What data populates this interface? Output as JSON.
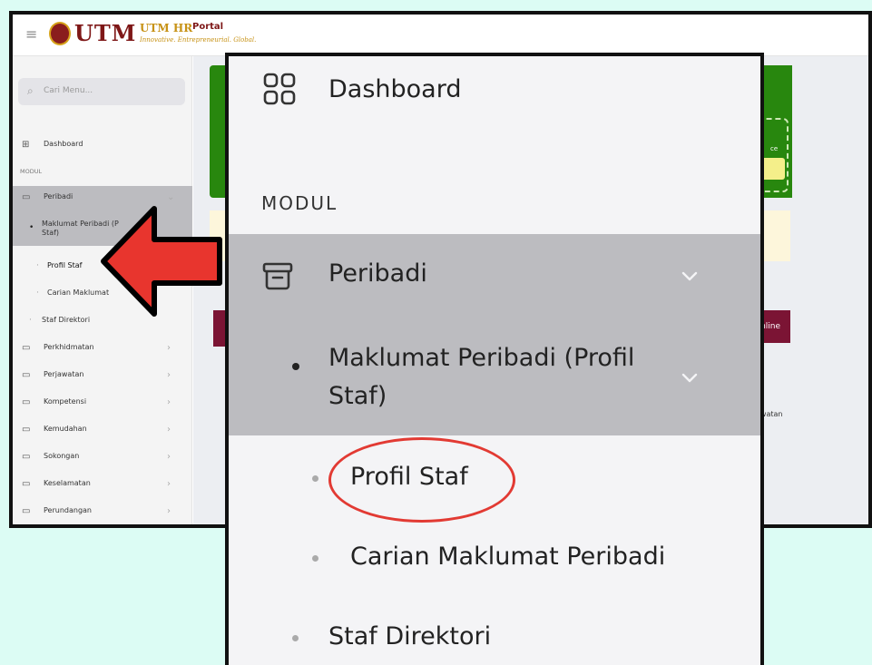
{
  "colors": {
    "page_background": "#dcfcf4",
    "highlight_arrow": "#e8352e",
    "highlight_circle": "#e23a33",
    "active_menu_bg": "#bcbcc0",
    "brand_maroon": "#7e1717",
    "brand_gold": "#c79216"
  },
  "background_screenshot": {
    "header": {
      "menu_icon": "hamburger-icon",
      "logo_text": "UTM",
      "hr_logo": "UTM HR",
      "portal_label": "Portal",
      "tagline": "Innovative. Entrepreneurial. Global."
    },
    "sidebar": {
      "search_placeholder": "Cari Menu...",
      "dashboard": "Dashboard",
      "section_label": "MODUL",
      "items": [
        {
          "label": "Peribadi",
          "icon": "archive-box-icon",
          "expanded": true
        },
        {
          "label": "Maklumat Peribadi (Profil Staf)",
          "level": 2
        },
        {
          "label": "Profil Staf",
          "level": 3
        },
        {
          "label": "Carian Maklumat Peribadi",
          "level": 3
        },
        {
          "label": "Staf Direktori",
          "level": 2
        },
        {
          "label": "Perkhidmatan",
          "icon": "archive-box-icon"
        },
        {
          "label": "Perjawatan",
          "icon": "archive-box-icon"
        },
        {
          "label": "Kompetensi",
          "icon": "archive-box-icon"
        },
        {
          "label": "Kemudahan",
          "icon": "archive-box-icon"
        },
        {
          "label": "Sokongan",
          "icon": "archive-box-icon"
        },
        {
          "label": "Keselamatan",
          "icon": "archive-box-icon"
        },
        {
          "label": "Perundangan",
          "icon": "archive-box-icon"
        }
      ],
      "visible_truncations": {
        "maklumat_peribadi": "Maklumat Peribadi (P",
        "maklumat_peribadi_line2": "Staf)",
        "carian": "Carian Maklumat"
      }
    },
    "main": {
      "card_text_fragment": "ce",
      "banner_text_fragment": "Online",
      "row_text_fragment": "awatan"
    }
  },
  "zoom_panel": {
    "dashboard": "Dashboard",
    "section_label": "MODUL",
    "peribadi": "Peribadi",
    "maklumat_peribadi": "Maklumat Peribadi (Profil Staf)",
    "profil_staf": "Profil Staf",
    "carian_maklumat_peribadi": "Carian Maklumat Peribadi",
    "staf_direktori": "Staf Direktori"
  }
}
